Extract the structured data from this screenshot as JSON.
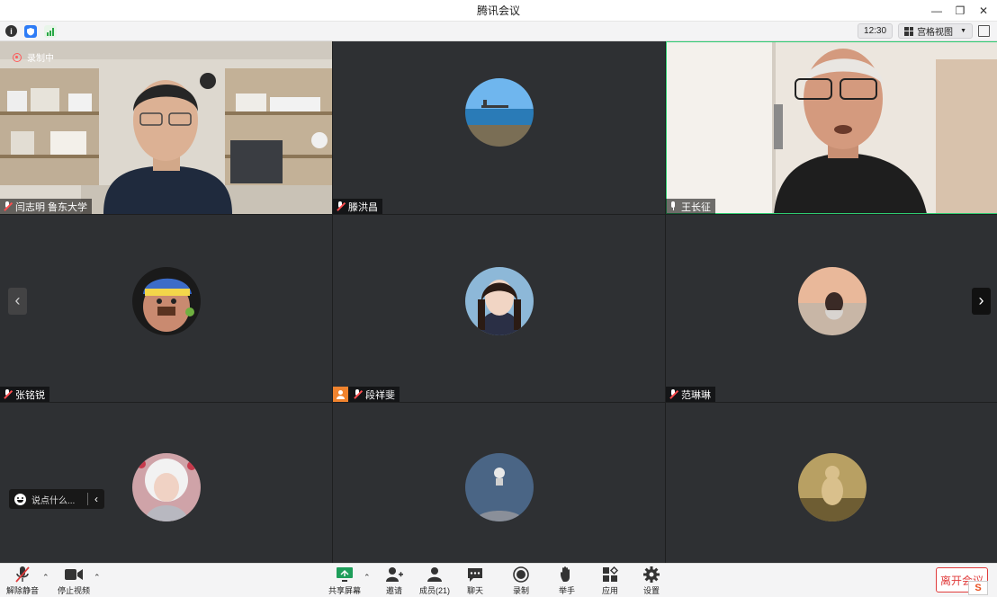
{
  "window": {
    "title": "腾讯会议"
  },
  "infobar": {
    "time": "12:30",
    "view_label": "宫格视图"
  },
  "recording_label": "录制中",
  "participants": [
    {
      "name": "闫志明 鲁东大学",
      "mic": "muted"
    },
    {
      "name": "滕洪昌",
      "mic": "muted"
    },
    {
      "name": "王长征",
      "mic": "on"
    },
    {
      "name": "张铭锐",
      "mic": "muted"
    },
    {
      "name": "段祥斐",
      "mic": "muted",
      "host": true
    },
    {
      "name": "范琳琳",
      "mic": "muted"
    },
    {
      "name": "",
      "mic": ""
    },
    {
      "name": "",
      "mic": ""
    },
    {
      "name": "",
      "mic": ""
    }
  ],
  "chat": {
    "placeholder": "说点什么..."
  },
  "toolbar": {
    "unmute": "解除静音",
    "stop_video": "停止视频",
    "share_screen": "共享屏幕",
    "invite": "邀请",
    "members": "成员(21)",
    "chat": "聊天",
    "record": "录制",
    "raise_hand": "举手",
    "apps": "应用",
    "settings": "设置",
    "leave": "离开会议"
  },
  "colors": {
    "accent_green": "#2ecc71",
    "leave_red": "#e03c3c",
    "host_orange": "#f0832e"
  }
}
